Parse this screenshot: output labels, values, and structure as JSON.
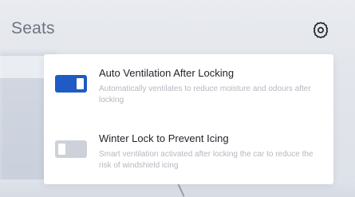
{
  "header": {
    "title": "Seats",
    "settings_icon": "gear-icon"
  },
  "popup": {
    "options": [
      {
        "title": "Auto Ventilation After Locking",
        "description": "Automatically ventilates to reduce moisture and odours after locking",
        "enabled": true
      },
      {
        "title": "Winter Lock to Prevent Icing",
        "description": "Smart ventilation activated after locking the car to reduce the risk of windshield icing",
        "enabled": false
      }
    ]
  },
  "colors": {
    "toggle_on": "#1f5bc4",
    "toggle_off": "#cdd1d9",
    "title_text": "#1f232a",
    "description_text": "#b4b8c0",
    "header_text": "#6e7480"
  }
}
